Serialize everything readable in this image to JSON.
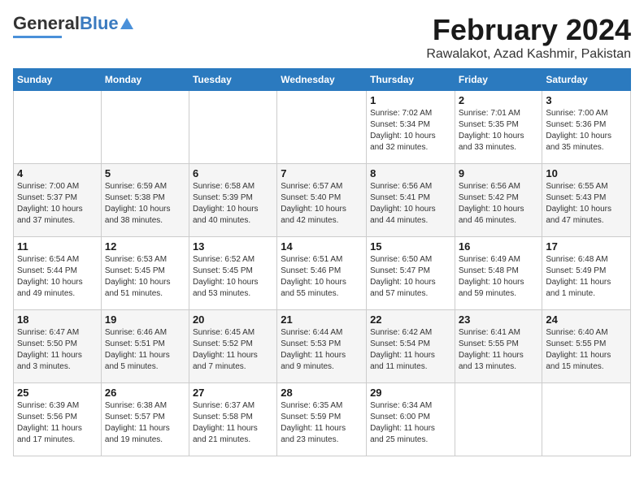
{
  "header": {
    "logo_general": "General",
    "logo_blue": "Blue",
    "month_title": "February 2024",
    "location": "Rawalakot, Azad Kashmir, Pakistan"
  },
  "weekdays": [
    "Sunday",
    "Monday",
    "Tuesday",
    "Wednesday",
    "Thursday",
    "Friday",
    "Saturday"
  ],
  "weeks": [
    [
      {
        "day": "",
        "info": ""
      },
      {
        "day": "",
        "info": ""
      },
      {
        "day": "",
        "info": ""
      },
      {
        "day": "",
        "info": ""
      },
      {
        "day": "1",
        "info": "Sunrise: 7:02 AM\nSunset: 5:34 PM\nDaylight: 10 hours\nand 32 minutes."
      },
      {
        "day": "2",
        "info": "Sunrise: 7:01 AM\nSunset: 5:35 PM\nDaylight: 10 hours\nand 33 minutes."
      },
      {
        "day": "3",
        "info": "Sunrise: 7:00 AM\nSunset: 5:36 PM\nDaylight: 10 hours\nand 35 minutes."
      }
    ],
    [
      {
        "day": "4",
        "info": "Sunrise: 7:00 AM\nSunset: 5:37 PM\nDaylight: 10 hours\nand 37 minutes."
      },
      {
        "day": "5",
        "info": "Sunrise: 6:59 AM\nSunset: 5:38 PM\nDaylight: 10 hours\nand 38 minutes."
      },
      {
        "day": "6",
        "info": "Sunrise: 6:58 AM\nSunset: 5:39 PM\nDaylight: 10 hours\nand 40 minutes."
      },
      {
        "day": "7",
        "info": "Sunrise: 6:57 AM\nSunset: 5:40 PM\nDaylight: 10 hours\nand 42 minutes."
      },
      {
        "day": "8",
        "info": "Sunrise: 6:56 AM\nSunset: 5:41 PM\nDaylight: 10 hours\nand 44 minutes."
      },
      {
        "day": "9",
        "info": "Sunrise: 6:56 AM\nSunset: 5:42 PM\nDaylight: 10 hours\nand 46 minutes."
      },
      {
        "day": "10",
        "info": "Sunrise: 6:55 AM\nSunset: 5:43 PM\nDaylight: 10 hours\nand 47 minutes."
      }
    ],
    [
      {
        "day": "11",
        "info": "Sunrise: 6:54 AM\nSunset: 5:44 PM\nDaylight: 10 hours\nand 49 minutes."
      },
      {
        "day": "12",
        "info": "Sunrise: 6:53 AM\nSunset: 5:45 PM\nDaylight: 10 hours\nand 51 minutes."
      },
      {
        "day": "13",
        "info": "Sunrise: 6:52 AM\nSunset: 5:45 PM\nDaylight: 10 hours\nand 53 minutes."
      },
      {
        "day": "14",
        "info": "Sunrise: 6:51 AM\nSunset: 5:46 PM\nDaylight: 10 hours\nand 55 minutes."
      },
      {
        "day": "15",
        "info": "Sunrise: 6:50 AM\nSunset: 5:47 PM\nDaylight: 10 hours\nand 57 minutes."
      },
      {
        "day": "16",
        "info": "Sunrise: 6:49 AM\nSunset: 5:48 PM\nDaylight: 10 hours\nand 59 minutes."
      },
      {
        "day": "17",
        "info": "Sunrise: 6:48 AM\nSunset: 5:49 PM\nDaylight: 11 hours\nand 1 minute."
      }
    ],
    [
      {
        "day": "18",
        "info": "Sunrise: 6:47 AM\nSunset: 5:50 PM\nDaylight: 11 hours\nand 3 minutes."
      },
      {
        "day": "19",
        "info": "Sunrise: 6:46 AM\nSunset: 5:51 PM\nDaylight: 11 hours\nand 5 minutes."
      },
      {
        "day": "20",
        "info": "Sunrise: 6:45 AM\nSunset: 5:52 PM\nDaylight: 11 hours\nand 7 minutes."
      },
      {
        "day": "21",
        "info": "Sunrise: 6:44 AM\nSunset: 5:53 PM\nDaylight: 11 hours\nand 9 minutes."
      },
      {
        "day": "22",
        "info": "Sunrise: 6:42 AM\nSunset: 5:54 PM\nDaylight: 11 hours\nand 11 minutes."
      },
      {
        "day": "23",
        "info": "Sunrise: 6:41 AM\nSunset: 5:55 PM\nDaylight: 11 hours\nand 13 minutes."
      },
      {
        "day": "24",
        "info": "Sunrise: 6:40 AM\nSunset: 5:55 PM\nDaylight: 11 hours\nand 15 minutes."
      }
    ],
    [
      {
        "day": "25",
        "info": "Sunrise: 6:39 AM\nSunset: 5:56 PM\nDaylight: 11 hours\nand 17 minutes."
      },
      {
        "day": "26",
        "info": "Sunrise: 6:38 AM\nSunset: 5:57 PM\nDaylight: 11 hours\nand 19 minutes."
      },
      {
        "day": "27",
        "info": "Sunrise: 6:37 AM\nSunset: 5:58 PM\nDaylight: 11 hours\nand 21 minutes."
      },
      {
        "day": "28",
        "info": "Sunrise: 6:35 AM\nSunset: 5:59 PM\nDaylight: 11 hours\nand 23 minutes."
      },
      {
        "day": "29",
        "info": "Sunrise: 6:34 AM\nSunset: 6:00 PM\nDaylight: 11 hours\nand 25 minutes."
      },
      {
        "day": "",
        "info": ""
      },
      {
        "day": "",
        "info": ""
      }
    ]
  ]
}
